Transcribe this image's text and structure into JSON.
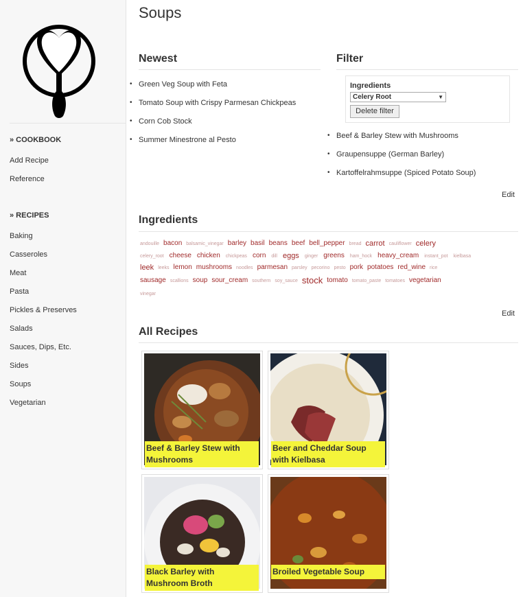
{
  "sidebar": {
    "cookbook_title": "» COOKBOOK",
    "cookbook_links": [
      "Add Recipe",
      "Reference"
    ],
    "recipes_title": "» RECIPES",
    "recipe_links": [
      "Baking",
      "Casseroles",
      "Meat",
      "Pasta",
      "Pickles & Preserves",
      "Salads",
      "Sauces, Dips, Etc.",
      "Sides",
      "Soups",
      "Vegetarian"
    ]
  },
  "page": {
    "title": "Soups"
  },
  "newest": {
    "title": "Newest",
    "items": [
      "Green Veg Soup with Feta",
      "Tomato Soup with Crispy Parmesan Chickpeas",
      "Corn Cob Stock",
      "Summer Minestrone al Pesto"
    ]
  },
  "filter": {
    "title": "Filter",
    "label": "Ingredients",
    "selected": "Celery Root",
    "delete_label": "Delete filter",
    "results": [
      "Beef & Barley Stew with Mushrooms",
      "Graupensuppe (German Barley)",
      "Kartoffelrahmsuppe (Spiced Potato Soup)"
    ],
    "edit_label": "Edit"
  },
  "ingredients": {
    "title": "Ingredients",
    "edit_label": "Edit",
    "tags": [
      [
        "andouille",
        "s1"
      ],
      [
        "bacon",
        "s2"
      ],
      [
        "balsamic_vinegar",
        "s1"
      ],
      [
        "barley",
        "s2"
      ],
      [
        "basil",
        "s2"
      ],
      [
        "beans",
        "s2"
      ],
      [
        "beef",
        "s2"
      ],
      [
        "bell_pepper",
        "s2"
      ],
      [
        "bread",
        "s1"
      ],
      [
        "carrot",
        "s3"
      ],
      [
        "cauliflower",
        "s1"
      ],
      [
        "celery",
        "s3"
      ],
      [
        "celery_root",
        "s1"
      ],
      [
        "cheese",
        "s2"
      ],
      [
        "chicken",
        "s2"
      ],
      [
        "chickpeas",
        "s1"
      ],
      [
        "corn",
        "s2"
      ],
      [
        "dill",
        "s1"
      ],
      [
        "eggs",
        "s3"
      ],
      [
        "ginger",
        "s1"
      ],
      [
        "greens",
        "s2"
      ],
      [
        "ham_hock",
        "s1"
      ],
      [
        "heavy_cream",
        "s2"
      ],
      [
        "instant_pot",
        "s1"
      ],
      [
        "kielbasa",
        "s1"
      ],
      [
        "leek",
        "s3"
      ],
      [
        "leeks",
        "s1"
      ],
      [
        "lemon",
        "s2"
      ],
      [
        "mushrooms",
        "s2"
      ],
      [
        "noodles",
        "s1"
      ],
      [
        "parmesan",
        "s2"
      ],
      [
        "parsley",
        "s1"
      ],
      [
        "pecorino",
        "s1"
      ],
      [
        "pesto",
        "s1"
      ],
      [
        "pork",
        "s2"
      ],
      [
        "potatoes",
        "s2"
      ],
      [
        "red_wine",
        "s2"
      ],
      [
        "rice",
        "s1"
      ],
      [
        "sausage",
        "s2"
      ],
      [
        "scallions",
        "s1"
      ],
      [
        "soup",
        "s2"
      ],
      [
        "sour_cream",
        "s2"
      ],
      [
        "southern",
        "s1"
      ],
      [
        "soy_sauce",
        "s1"
      ],
      [
        "stock",
        "s4"
      ],
      [
        "tomato",
        "s2"
      ],
      [
        "tomato_paste",
        "s1"
      ],
      [
        "tomatoes",
        "s1"
      ],
      [
        "vegetarian",
        "s2"
      ],
      [
        "vinegar",
        "s1"
      ]
    ]
  },
  "all_recipes": {
    "title": "All Recipes",
    "cards": [
      "Beef & Barley Stew with Mushrooms",
      "Beer and Cheddar Soup with Kielbasa",
      "Black Barley with Mushroom Broth",
      "Broiled Vegetable Soup"
    ]
  },
  "colors": {
    "tag": "#a02a2a",
    "caption_bg": "#f4f43a",
    "sidebar_bg": "#f7f7f7"
  }
}
